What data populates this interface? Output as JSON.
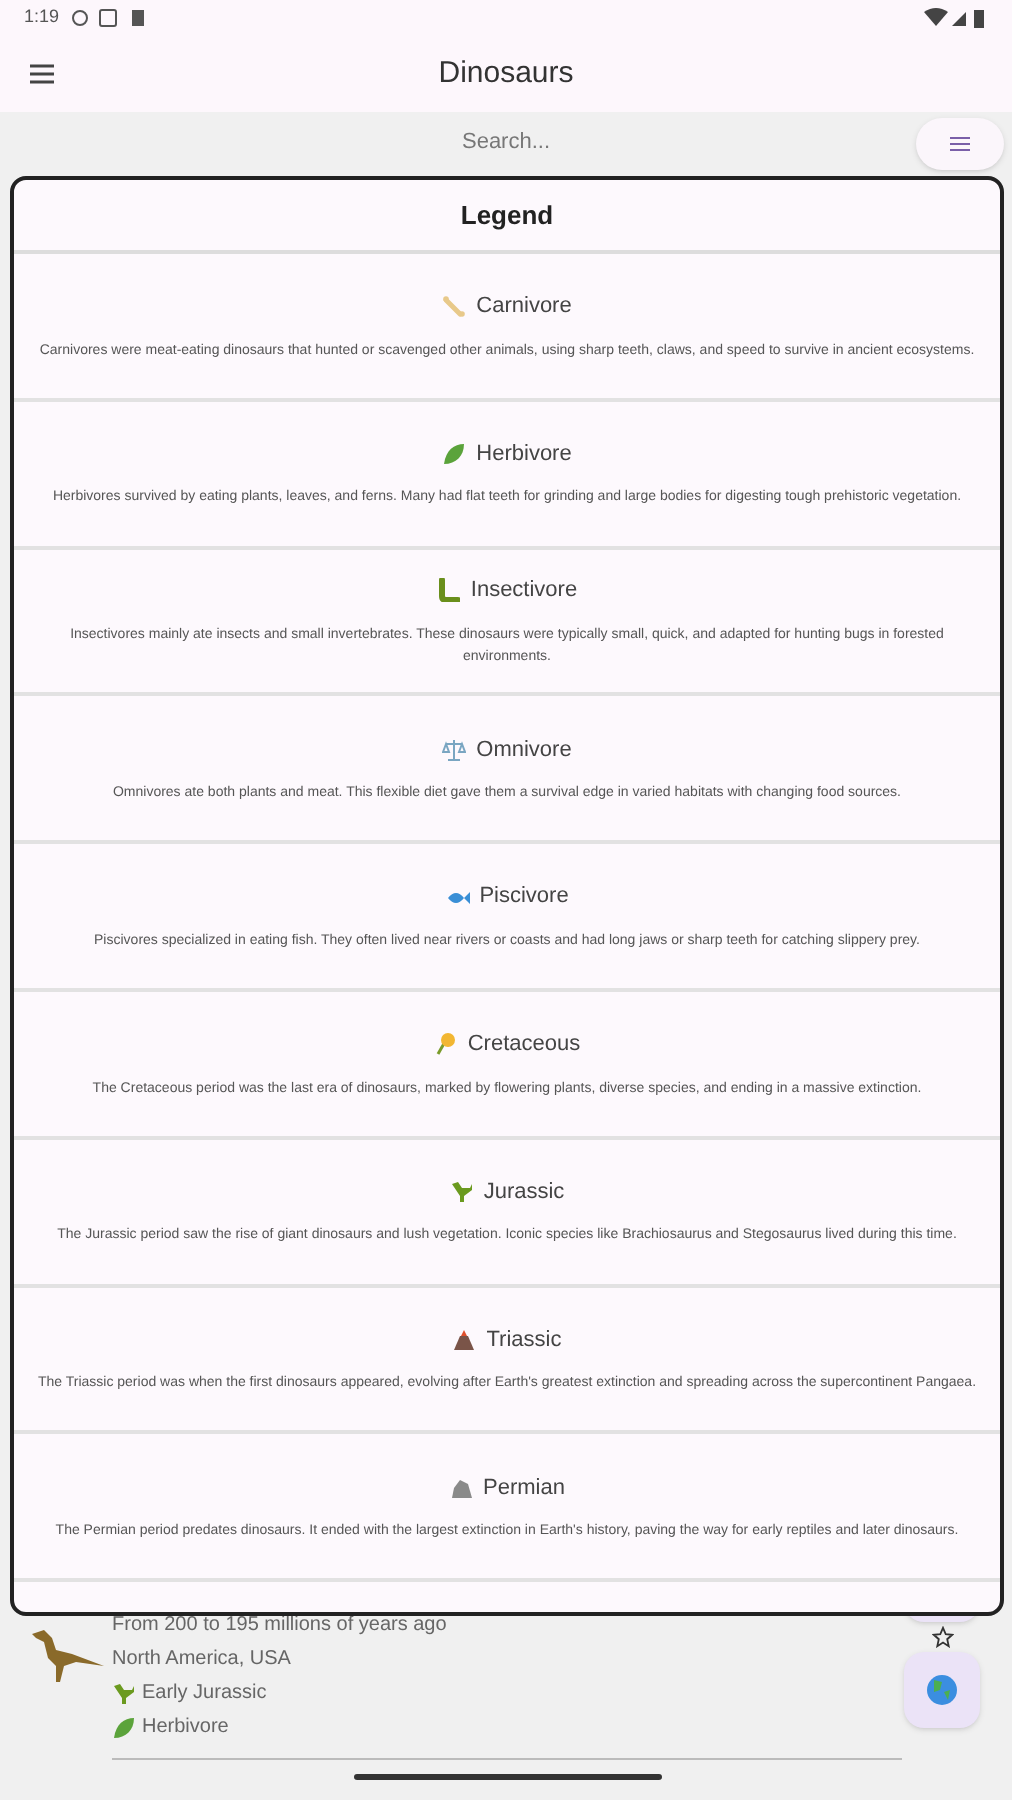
{
  "status_bar": {
    "time": "1:19"
  },
  "app_bar": {
    "title": "Dinosaurs"
  },
  "search": {
    "placeholder": "Search..."
  },
  "list_item": {
    "lines": [
      "From 200 to 195 millions of years ago",
      "North America, USA"
    ],
    "tags": [
      {
        "kind": "jurassic",
        "label": "Early Jurassic"
      },
      {
        "kind": "herbivore",
        "label": "Herbivore"
      }
    ]
  },
  "legend": {
    "title": "Legend",
    "entries": [
      {
        "kind": "carnivore",
        "title": "Carnivore",
        "text": "Carnivores were meat-eating dinosaurs that hunted or scavenged other animals, using sharp teeth, claws, and speed to survive in ancient ecosystems."
      },
      {
        "kind": "herbivore",
        "title": "Herbivore",
        "text": "Herbivores survived by eating plants, leaves, and ferns. Many had flat teeth for grinding and large bodies for digesting tough prehistoric vegetation."
      },
      {
        "kind": "insectivore",
        "title": "Insectivore",
        "text": "Insectivores mainly ate insects and small invertebrates. These dinosaurs were typically small, quick, and adapted for hunting bugs in forested environments."
      },
      {
        "kind": "omnivore",
        "title": "Omnivore",
        "text": "Omnivores ate both plants and meat. This flexible diet gave them a survival edge in varied habitats with changing food sources."
      },
      {
        "kind": "piscivore",
        "title": "Piscivore",
        "text": "Piscivores specialized in eating fish. They often lived near rivers or coasts and had long jaws or sharp teeth for catching slippery prey."
      },
      {
        "kind": "cretaceous",
        "title": "Cretaceous",
        "text": "The Cretaceous period was the last era of dinosaurs, marked by flowering plants, diverse species, and ending in a massive extinction."
      },
      {
        "kind": "jurassic",
        "title": "Jurassic",
        "text": "The Jurassic period saw the rise of giant dinosaurs and lush vegetation. Iconic species like Brachiosaurus and Stegosaurus lived during this time."
      },
      {
        "kind": "triassic",
        "title": "Triassic",
        "text": "The Triassic period was when the first dinosaurs appeared, evolving after Earth's greatest extinction and spreading across the supercontinent Pangaea."
      },
      {
        "kind": "permian",
        "title": "Permian",
        "text": "The Permian period predates dinosaurs. It ended with the largest extinction in Earth's history, paving the way for early reptiles and later dinosaurs."
      }
    ]
  }
}
